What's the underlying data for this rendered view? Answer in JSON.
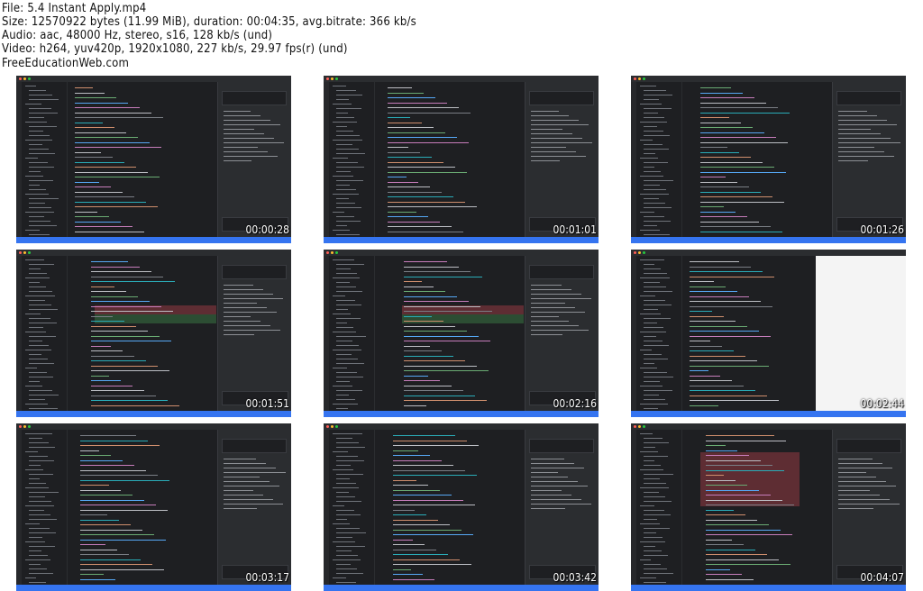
{
  "header": {
    "lines": [
      "File: 5.4 Instant Apply.mp4",
      "Size: 12570922 bytes (11.99 MiB), duration: 00:04:35, avg.bitrate: 366 kb/s",
      "Audio: aac, 48000 Hz, stereo, s16, 128 kb/s (und)",
      "Video: h264, yuv420p, 1920x1080, 227 kb/s, 29.97 fps(r) (und)",
      "FreeEducationWeb.com"
    ]
  },
  "thumbnails": [
    {
      "timestamp": "00:00:28",
      "variant": "chat"
    },
    {
      "timestamp": "00:01:01",
      "variant": "chat"
    },
    {
      "timestamp": "00:01:26",
      "variant": "chat"
    },
    {
      "timestamp": "00:01:51",
      "variant": "diff"
    },
    {
      "timestamp": "00:02:16",
      "variant": "diff"
    },
    {
      "timestamp": "00:02:44",
      "variant": "browser"
    },
    {
      "timestamp": "00:03:17",
      "variant": "chat"
    },
    {
      "timestamp": "00:03:42",
      "variant": "chat"
    },
    {
      "timestamp": "00:04:07",
      "variant": "red-block"
    }
  ],
  "colors": {
    "ide_background": "#1e1f22",
    "status_bar": "#3574f0",
    "diff_removed": "#5e2d33",
    "diff_added": "#2c4d33"
  }
}
